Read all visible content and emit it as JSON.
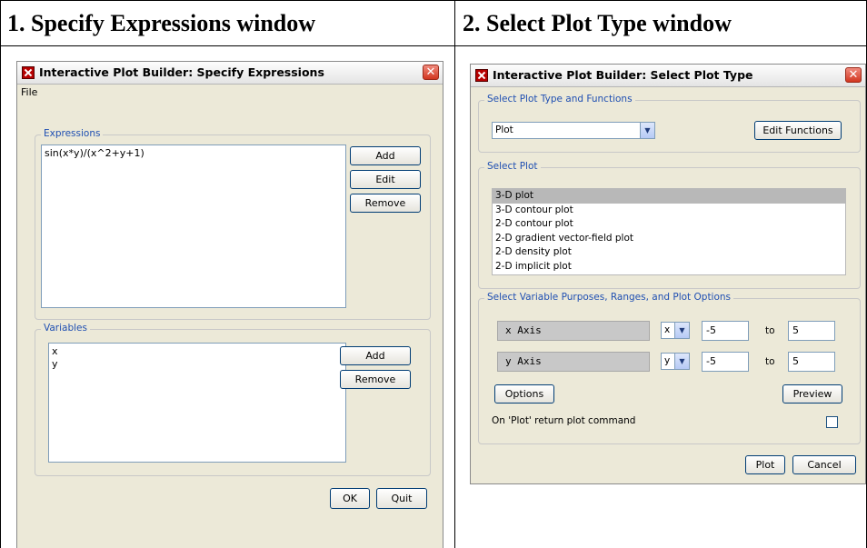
{
  "headers": {
    "left": "1. Specify Expressions window",
    "right": "2. Select Plot Type window"
  },
  "specify": {
    "title": "Interactive Plot Builder: Specify Expressions",
    "menu": [
      "File"
    ],
    "expressions": {
      "label": "Expressions",
      "value": "sin(x*y)/(x^2+y+1)",
      "buttons": {
        "add": "Add",
        "edit": "Edit",
        "remove": "Remove"
      }
    },
    "variables": {
      "label": "Variables",
      "items": [
        "x",
        "y"
      ],
      "buttons": {
        "add": "Add",
        "remove": "Remove"
      }
    },
    "footer": {
      "ok": "OK",
      "quit": "Quit"
    }
  },
  "plottype": {
    "title": "Interactive Plot Builder: Select Plot Type",
    "type_group": {
      "label": "Select Plot Type and Functions",
      "combo_value": "Plot",
      "edit_functions": "Edit Functions"
    },
    "select_plot": {
      "label": "Select Plot",
      "items": [
        "3-D plot",
        "3-D contour plot",
        "2-D contour plot",
        "2-D gradient vector-field plot",
        "2-D density plot",
        "2-D implicit plot"
      ],
      "selected_index": 0
    },
    "variables": {
      "label": "Select Variable Purposes, Ranges, and Plot Options",
      "rows": [
        {
          "axis": "x Axis",
          "var": "x",
          "from": "-5",
          "to_label": "to",
          "to": "5"
        },
        {
          "axis": "y Axis",
          "var": "y",
          "from": "-5",
          "to_label": "to",
          "to": "5"
        }
      ],
      "options": "Options",
      "preview": "Preview",
      "return_label": "On 'Plot' return plot command",
      "return_checked": false
    },
    "footer": {
      "plot": "Plot",
      "cancel": "Cancel"
    }
  }
}
